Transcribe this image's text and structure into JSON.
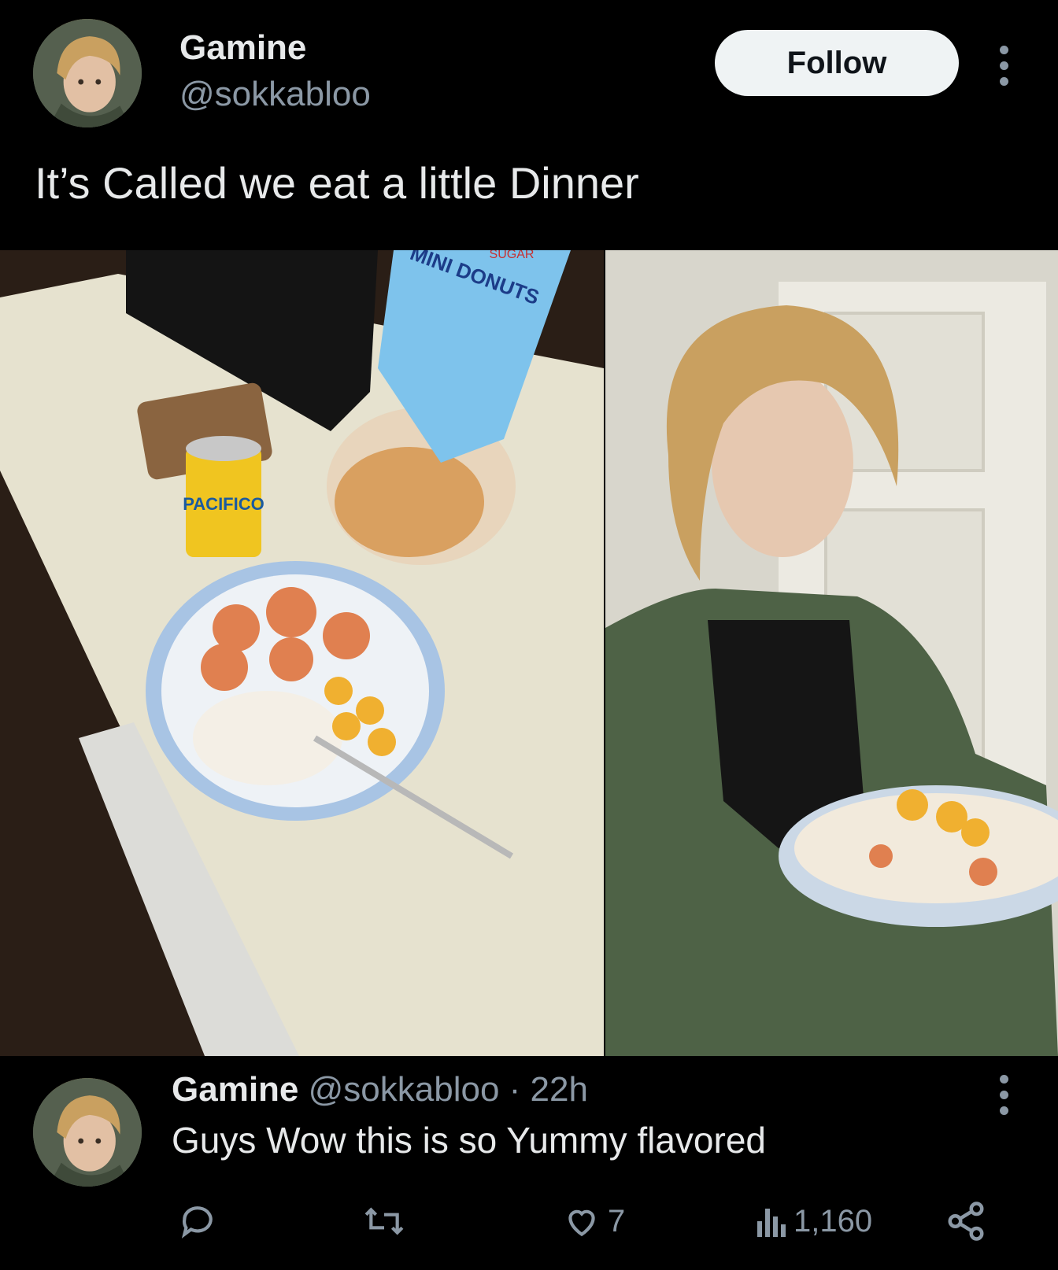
{
  "author": {
    "display_name": "Gamine",
    "handle": "@sokkabloo"
  },
  "follow_button": {
    "label": "Follow"
  },
  "tweet": {
    "text": "It’s Called we eat a little Dinner"
  },
  "media": {
    "left_photo_texts": [
      "MINI DONUTS",
      "SUGAR",
      "PACIFICO"
    ],
    "right_photo_icon": "selfie-photo"
  },
  "reply": {
    "display_name": "Gamine",
    "meta": "@sokkabloo · 22h",
    "text": "Guys Wow this is so Yummy flavored",
    "actions": {
      "reply_count": "",
      "repost_count": "",
      "like_count": "7",
      "views_count": "1,160"
    }
  },
  "colors": {
    "background": "#000000",
    "text_primary": "#e7e9ea",
    "text_secondary": "#8b98a5",
    "follow_bg": "#eff3f4"
  }
}
